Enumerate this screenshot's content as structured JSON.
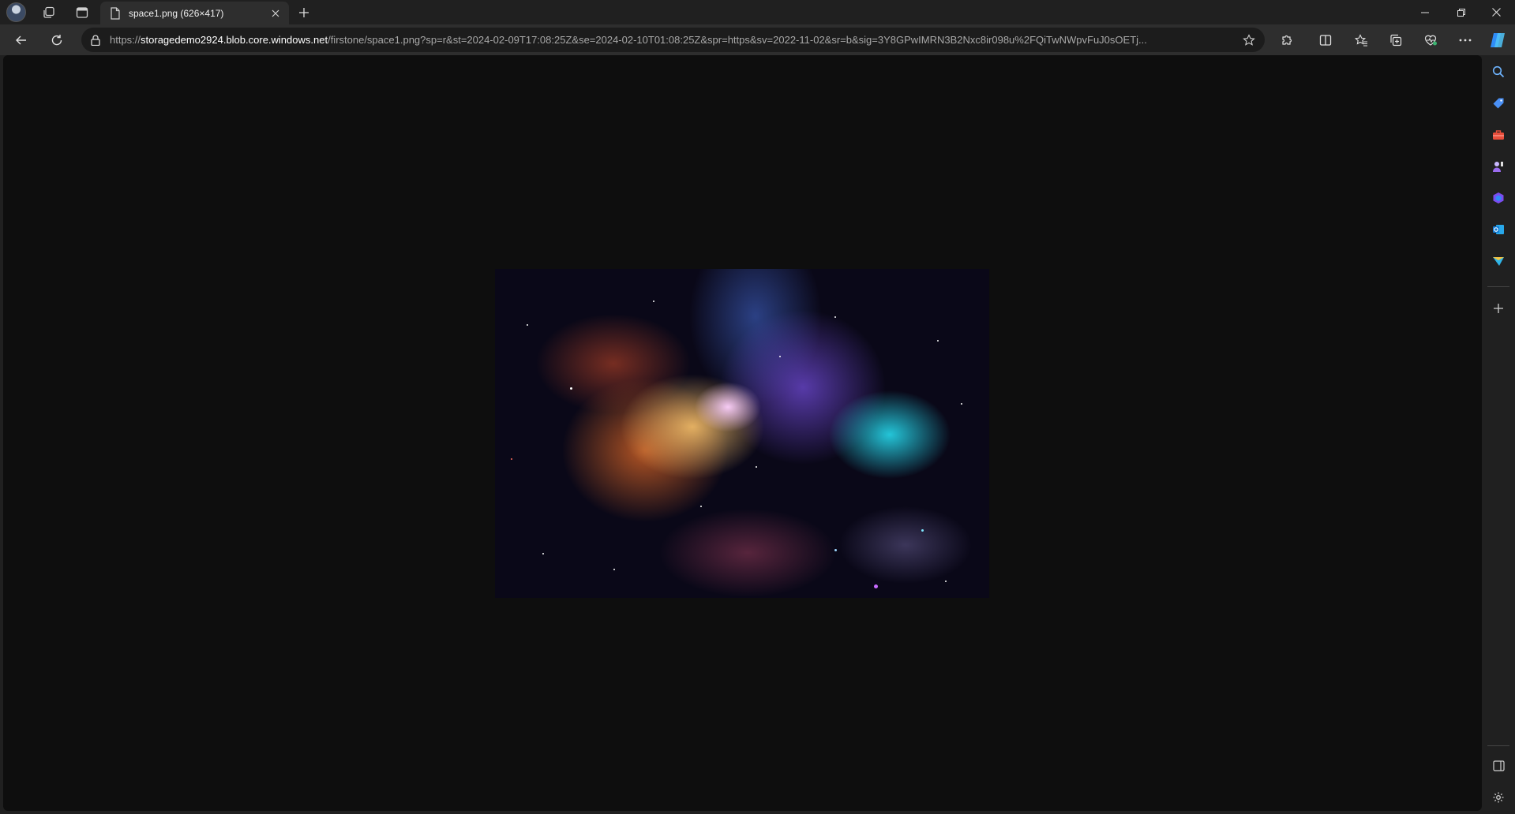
{
  "tab": {
    "title": "space1.png (626×417)"
  },
  "address_bar": {
    "scheme": "https://",
    "host": "storagedemo2924.blob.core.windows.net",
    "path": "/firstone/space1.png?sp=r&st=2024-02-09T17:08:25Z&se=2024-02-10T01:08:25Z&spr=https&sv=2022-11-02&sr=b&sig=3Y8GPwIMRN3B2Nxc8ir098u%2FQiTwNWpvFuJ0sOETj..."
  },
  "image": {
    "alt": "space1.png"
  },
  "colors": {
    "accent_copilot": "#2f8cf7",
    "shopping": "#4a90f5",
    "tools": "#e94e3b",
    "games": "#9b6cf0",
    "outlook": "#0f78d4"
  },
  "icons": {
    "profile": "avatar",
    "workspaces": "workspaces-icon",
    "vertical_tabs": "vertical-tabs-icon",
    "page": "file-icon",
    "close": "close-icon",
    "new_tab": "plus-icon",
    "back": "back-arrow-icon",
    "refresh": "refresh-icon",
    "lock": "lock-icon",
    "favorite": "star-icon",
    "extensions": "puzzle-icon",
    "split": "split-screen-icon",
    "favorites": "favorites-icon",
    "collections": "collections-icon",
    "performance": "heart-pulse-icon",
    "more": "more-icon",
    "copilot": "copilot-icon"
  }
}
